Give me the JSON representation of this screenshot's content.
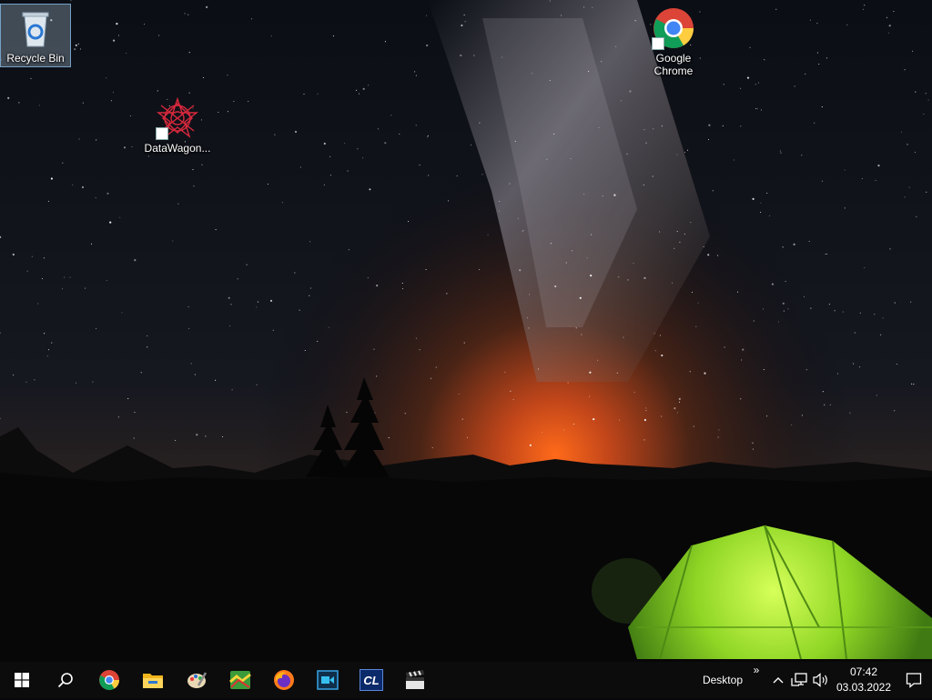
{
  "desktop": {
    "icons": [
      {
        "label": "Recycle Bin",
        "icon": "recycle-bin-icon"
      },
      {
        "label": "DataWagon...",
        "icon": "datawagon-icon"
      },
      {
        "label": "Google Chrome",
        "icon": "chrome-icon"
      }
    ]
  },
  "taskbar": {
    "start": {
      "icon": "windows-start-icon"
    },
    "search": {
      "icon": "search-icon"
    },
    "pinned": [
      {
        "icon": "chrome-icon"
      },
      {
        "icon": "file-explorer-icon"
      },
      {
        "icon": "paint-icon"
      },
      {
        "icon": "map-app-icon"
      },
      {
        "icon": "firefox-icon"
      },
      {
        "icon": "video-editor-icon"
      },
      {
        "icon": "cl-app-icon",
        "text": "CL"
      },
      {
        "icon": "clapperboard-icon"
      }
    ]
  },
  "tray": {
    "toolbar_label": "Desktop",
    "chevron": "»",
    "show_hidden_icon": "chevron-up-icon",
    "network_icon": "network-icon",
    "volume_icon": "volume-icon",
    "time": "07:42",
    "date": "03.03.2022",
    "notification_icon": "action-center-icon"
  },
  "colors": {
    "taskbar_bg": "#0c0c0c",
    "tent_green": "#9ee62a",
    "horizon_orange": "#e8641e"
  }
}
